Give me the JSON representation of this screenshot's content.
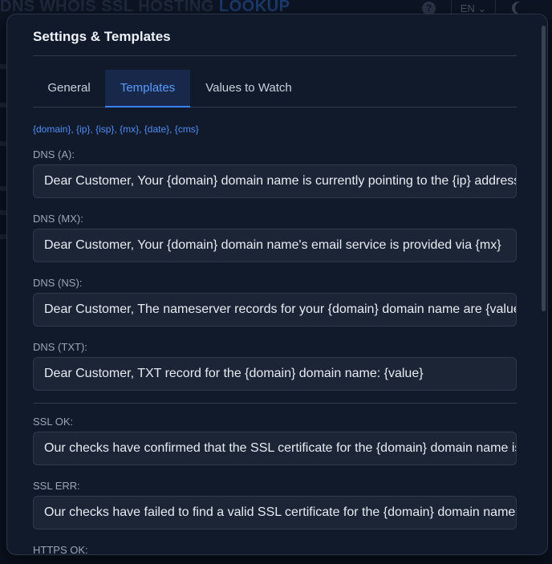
{
  "background": {
    "brand_part1": "DNS WHOIS SSL HOSTING",
    "brand_part2": "LOOKUP",
    "help_glyph": "?",
    "lang": "EN ⌄"
  },
  "modal": {
    "title": "Settings & Templates",
    "tabs": [
      {
        "label": "General",
        "active": false
      },
      {
        "label": "Templates",
        "active": true
      },
      {
        "label": "Values to Watch",
        "active": false
      }
    ],
    "variables_hint": "{domain}, {ip}, {isp}, {mx}, {date}, {cms}",
    "fields": [
      {
        "label": "DNS (A):",
        "value": "Dear Customer, Your {domain} domain name is currently pointing to the {ip} address"
      },
      {
        "label": "DNS (MX):",
        "value": "Dear Customer, Your {domain} domain name's email service is provided via {mx}"
      },
      {
        "label": "DNS (NS):",
        "value": "Dear Customer, The nameserver records for your {domain} domain name are {value}"
      },
      {
        "label": "DNS (TXT):",
        "value": "Dear Customer, TXT record for the {domain} domain name: {value}"
      },
      {
        "label": "SSL OK:",
        "value": "Our checks have confirmed that the SSL certificate for the {domain} domain name is valid"
      },
      {
        "label": "SSL ERR:",
        "value": "Our checks have failed to find a valid SSL certificate for the {domain} domain name"
      },
      {
        "label": "HTTPS OK:",
        "value": ""
      }
    ]
  },
  "colors": {
    "accent": "#3b82f6",
    "modal_bg": "#111a2b",
    "input_bg": "#1b2536"
  }
}
